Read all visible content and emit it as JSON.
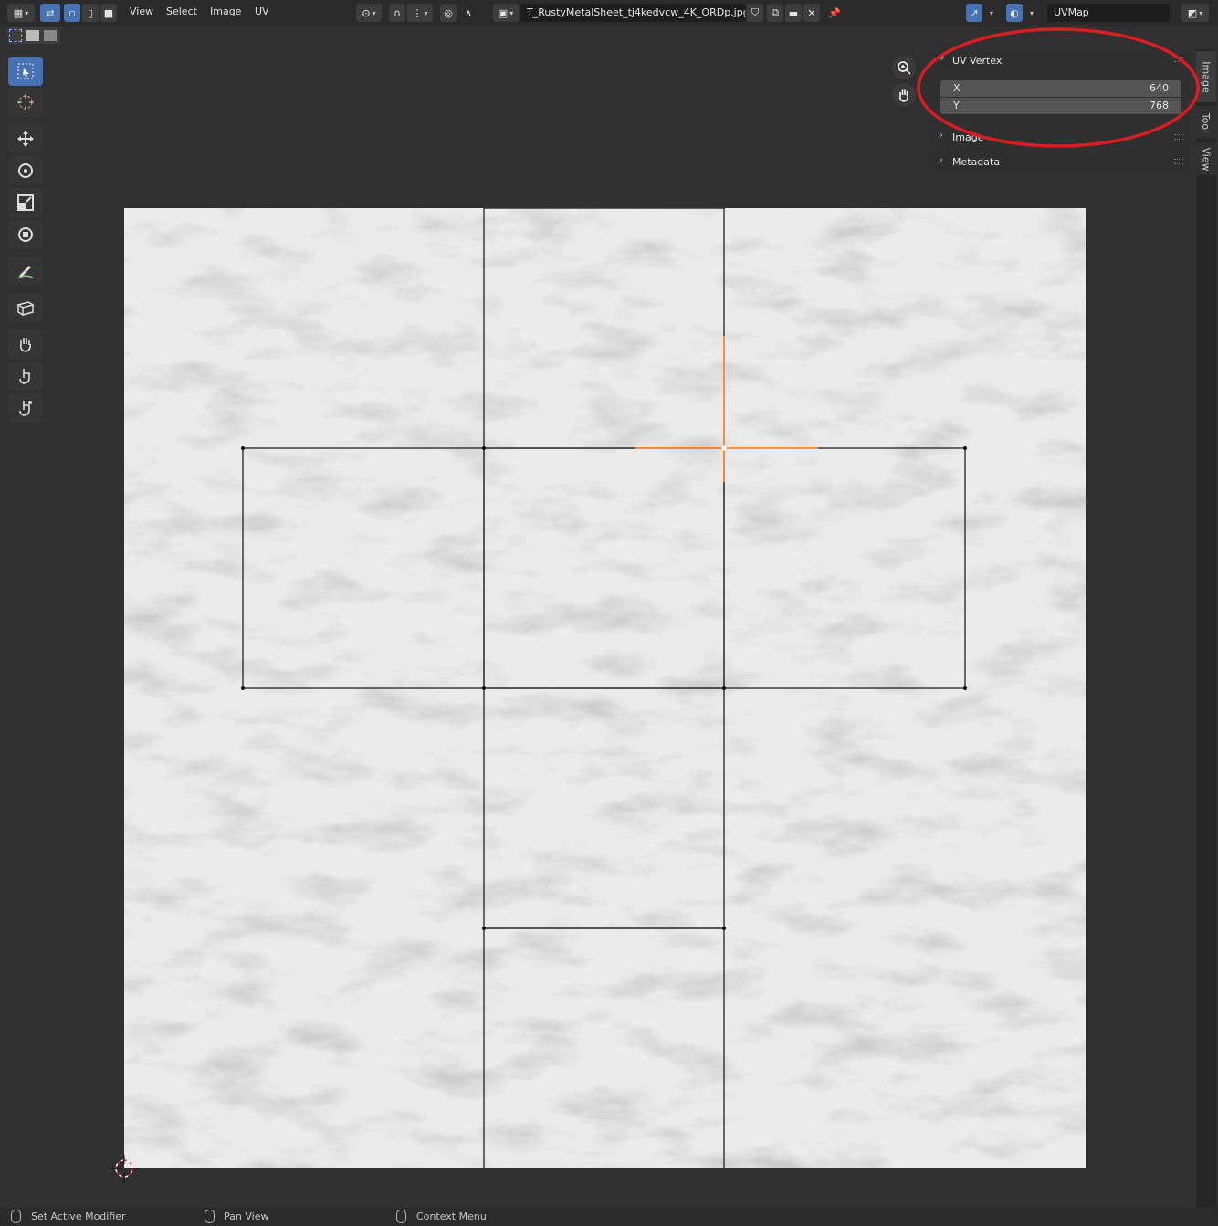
{
  "header": {
    "menus": [
      "View",
      "Select",
      "Image",
      "UV"
    ],
    "image_name": "T_RustyMetalSheet_tj4kedvcw_4K_ORDp.jpg",
    "uv_map": "UVMap"
  },
  "npanel": {
    "uv_vertex": {
      "title": "UV Vertex",
      "x_label": "X",
      "x_value": "640",
      "y_label": "Y",
      "y_value": "768"
    },
    "image_title": "Image",
    "metadata_title": "Metadata"
  },
  "sidetabs": [
    "Image",
    "Tool",
    "View"
  ],
  "status": {
    "left": "Set Active Modifier",
    "middle": "Pan View",
    "right": "Context Menu"
  },
  "colors": {
    "accent": "#4772b3",
    "annotation_circle": "#d81e24",
    "selected_edge": "#ff8a1c"
  },
  "icons": [
    "editor-type-icon",
    "uv-sync-icon",
    "vertex-select-icon",
    "edge-select-icon",
    "face-select-icon",
    "pivot-icon",
    "proportional-icon",
    "snap-icon",
    "image-browse-icon",
    "fake-user-icon",
    "new-image-icon",
    "open-image-icon",
    "unlink-icon",
    "pin-icon",
    "gizmo-icon",
    "overlay-icon",
    "display-channels-icon",
    "zoom-icon",
    "hand-icon",
    "cursor-icon"
  ]
}
